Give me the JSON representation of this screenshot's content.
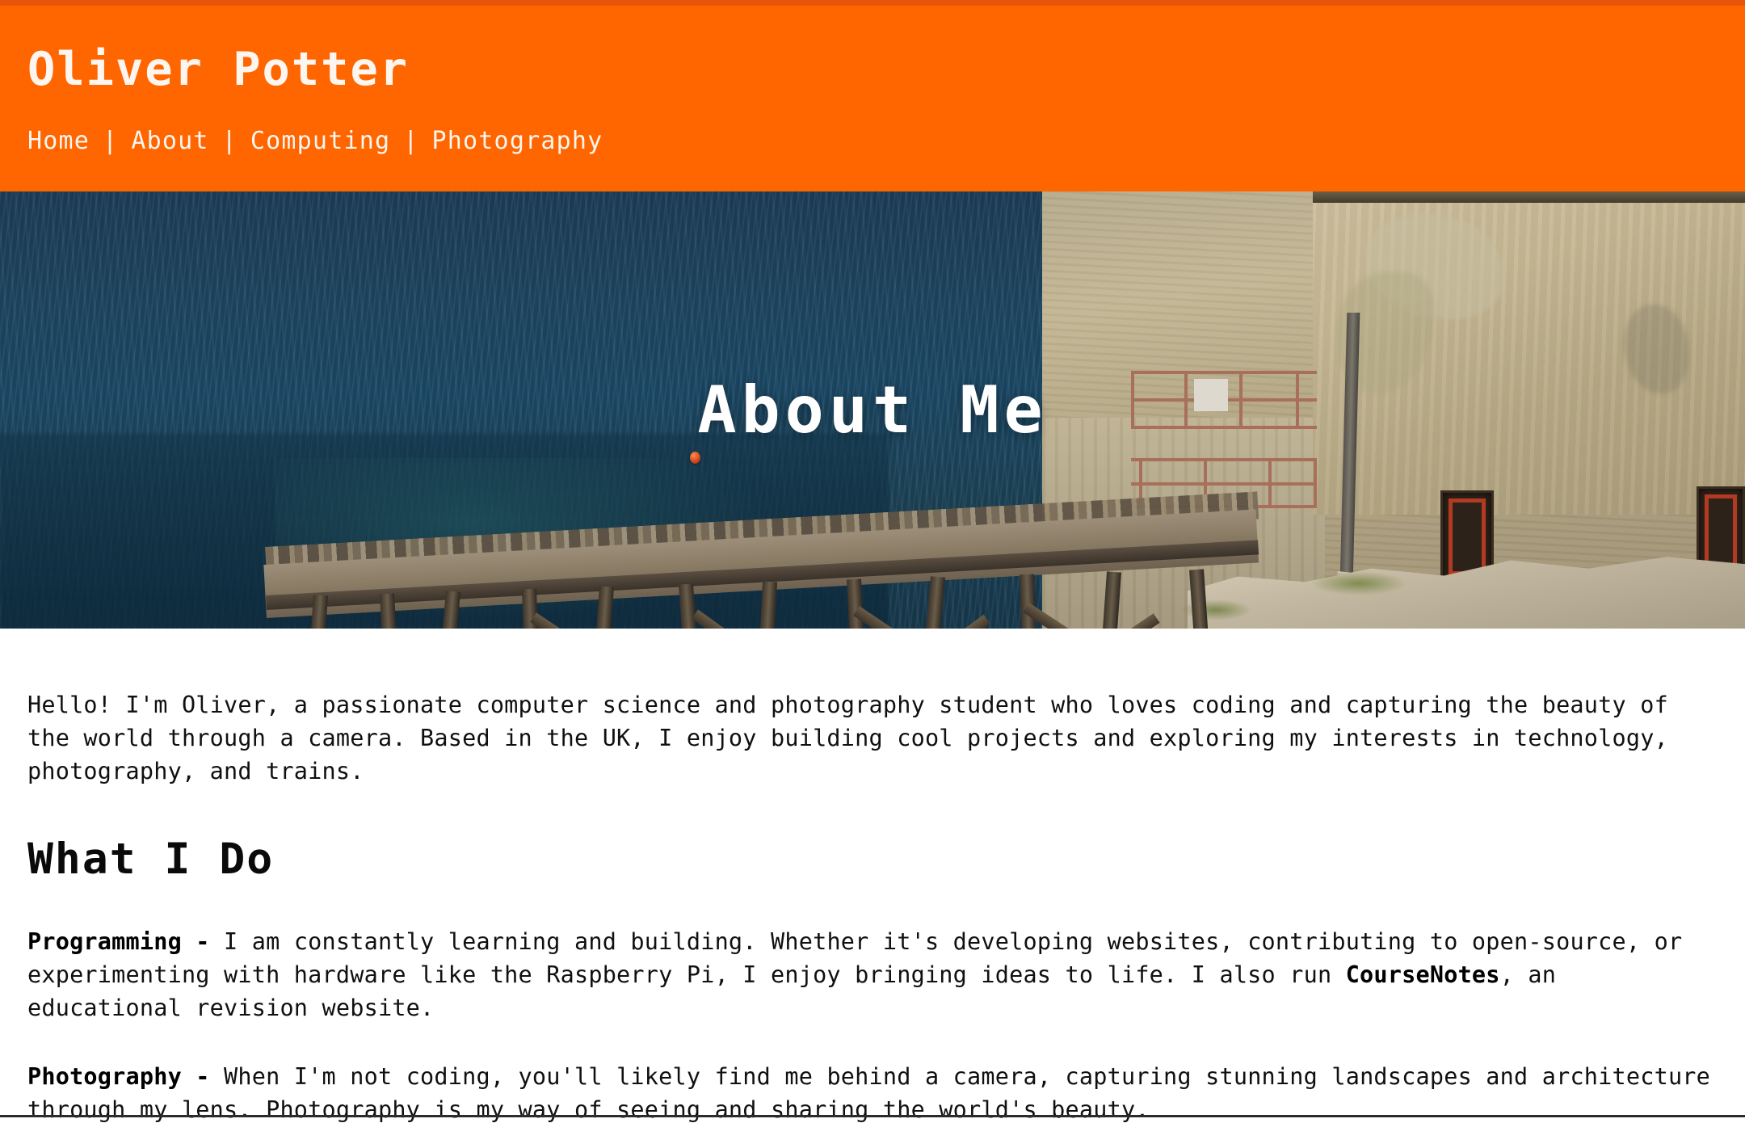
{
  "header": {
    "site_title": "Oliver Potter",
    "brand_color": "#ff6600",
    "text_color": "#fdf6f0",
    "nav": {
      "separator": "|",
      "items": [
        {
          "label": "Home"
        },
        {
          "label": "About"
        },
        {
          "label": "Computing"
        },
        {
          "label": "Photography"
        }
      ]
    }
  },
  "hero": {
    "title": "About Me",
    "image_alt": "Derelict wooden pier over blue sea with weathered concrete building on the right",
    "title_color": "#ffffff"
  },
  "main": {
    "intro": "Hello! I'm Oliver, a passionate computer science and photography student who loves coding and capturing the beauty of the world through a camera. Based in the UK, I enjoy building cool projects and exploring my interests in technology, photography, and trains.",
    "section_heading": "What I Do",
    "items": [
      {
        "lead": "Programming -",
        "body_part_1": " I am constantly learning and building. Whether it's developing websites, contributing to open-source, or experimenting with hardware like the Raspberry Pi, I enjoy bringing ideas to life. I also run ",
        "highlight": "CourseNotes",
        "body_part_2": ", an educational revision website."
      },
      {
        "lead": "Photography -",
        "body_part_1": " When I'm not coding, you'll likely find me behind a camera, capturing stunning landscapes and architecture through my lens. Photography is my way of seeing and sharing the world's beauty.",
        "highlight": "",
        "body_part_2": ""
      }
    ]
  }
}
